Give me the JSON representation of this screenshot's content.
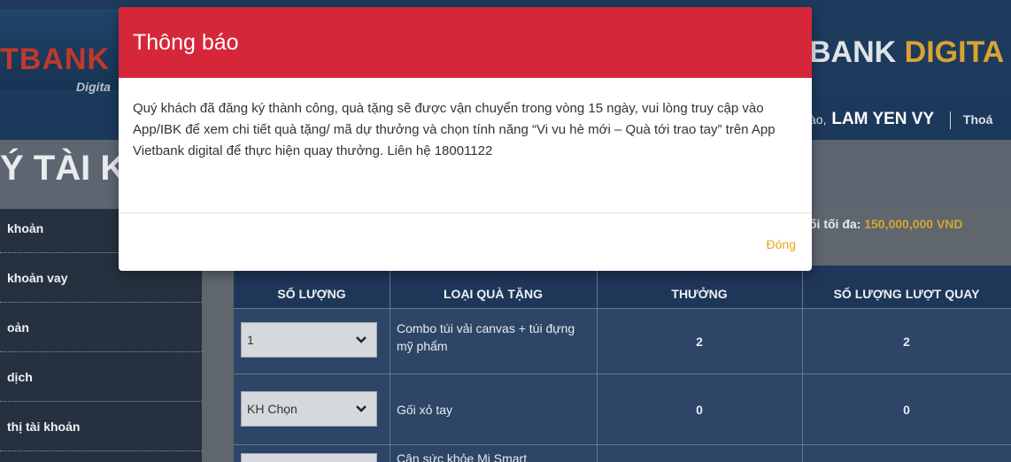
{
  "header": {
    "logo_main": "TBANK",
    "logo_sub": "Digita",
    "brand_right_main": "BANK ",
    "brand_right_accent": "DIGITA"
  },
  "nav": {
    "greeting_partial": "ào,",
    "user_name": "LAM YEN VY",
    "logout_partial": "Thoá"
  },
  "section": {
    "title": "Ý TÀI KH"
  },
  "sidebar": {
    "items": [
      {
        "label": "khoản"
      },
      {
        "label": "khoản vay"
      },
      {
        "label": "oản"
      },
      {
        "label": "dịch"
      },
      {
        "label": "thị tài khoản"
      }
    ]
  },
  "limit": {
    "label": "ối tối đa: ",
    "amount": "150,000,000 VND"
  },
  "table": {
    "headers": [
      "SỐ LƯỢNG",
      "LOẠI QUÀ TẶNG",
      "THƯỞNG",
      "SỐ LƯỢNG LƯỢT QUAY"
    ],
    "rows": [
      {
        "quantity": "1",
        "gift": "Combo túi vải canvas + túi đựng mỹ phẩm",
        "points": "2",
        "spins": "2"
      },
      {
        "quantity": "KH Chọn",
        "gift": "Gối xỏ tay",
        "points": "0",
        "spins": "0"
      },
      {
        "quantity": "",
        "gift": "Cân sức khỏe Mi Smart",
        "points": "",
        "spins": ""
      }
    ]
  },
  "modal": {
    "title": "Thông báo",
    "body": "Quý khách đã đăng ký thành công, quà tặng sẽ được vận chuyển trong vòng 15 ngày, vui lòng truy cập vào App/IBK để xem chi tiết quà tặng/ mã dự thưởng và chọn tính năng “Vi vu hè mới – Quà tới trao tay” trên App Vietbank digital để thực hiện quay thưởng. Liên hệ 18001122",
    "close_label": "Đóng"
  },
  "colors": {
    "modal_header": "#d6263a",
    "close_link": "#e8a317",
    "brand_accent": "#d8a430"
  }
}
